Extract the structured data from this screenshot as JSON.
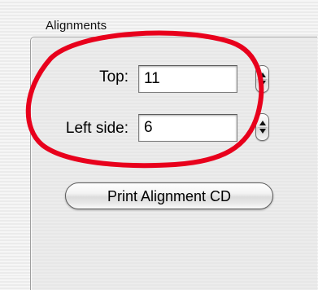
{
  "group": {
    "title": "Alignments"
  },
  "fields": {
    "top": {
      "label": "Top:",
      "value": "11"
    },
    "left_side": {
      "label": "Left side:",
      "value": "6"
    }
  },
  "buttons": {
    "print_alignment_label": "Print Alignment CD"
  },
  "annotation": {
    "shape": "ellipse-outline",
    "color": "#e8001c"
  },
  "icons": {
    "stepper": "up-down-stepper-arrows"
  }
}
